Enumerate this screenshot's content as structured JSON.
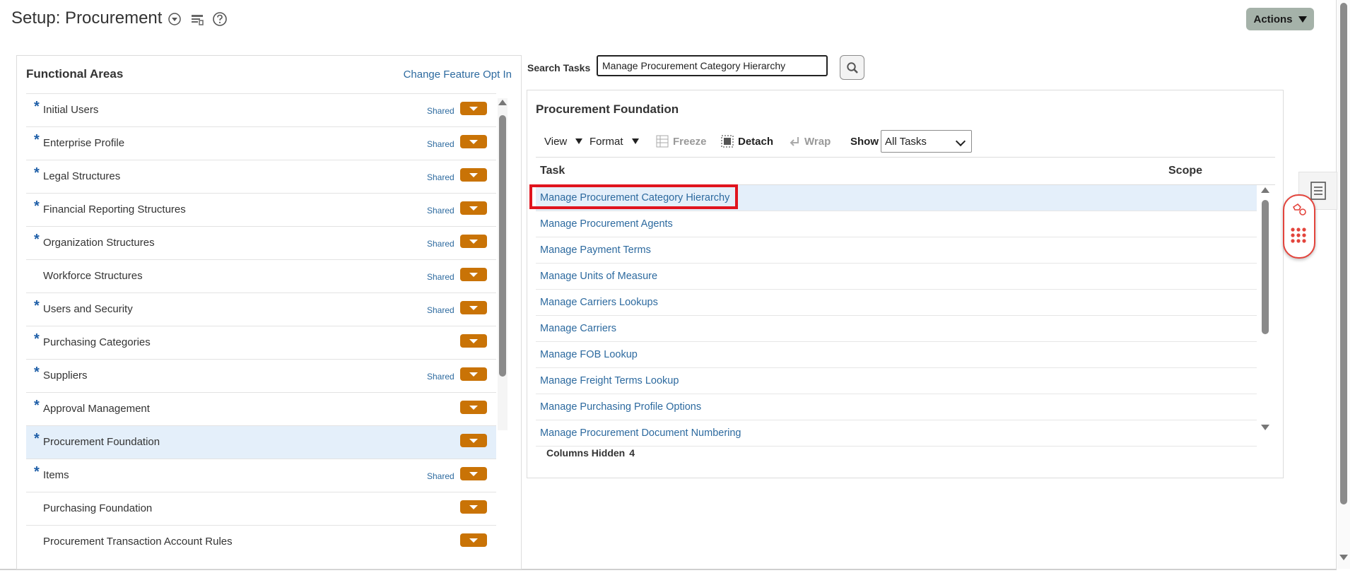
{
  "page": {
    "title": "Setup: Procurement",
    "actions_label": "Actions"
  },
  "functional_areas": {
    "header": "Functional Areas",
    "change_link": "Change Feature Opt In",
    "items": [
      {
        "label": "Initial Users",
        "required": true,
        "shared": "Shared"
      },
      {
        "label": "Enterprise Profile",
        "required": true,
        "shared": "Shared"
      },
      {
        "label": "Legal Structures",
        "required": true,
        "shared": "Shared"
      },
      {
        "label": "Financial Reporting Structures",
        "required": true,
        "shared": "Shared"
      },
      {
        "label": "Organization Structures",
        "required": true,
        "shared": "Shared"
      },
      {
        "label": "Workforce Structures",
        "required": false,
        "shared": "Shared"
      },
      {
        "label": "Users and Security",
        "required": true,
        "shared": "Shared"
      },
      {
        "label": "Purchasing Categories",
        "required": true,
        "shared": ""
      },
      {
        "label": "Suppliers",
        "required": true,
        "shared": "Shared"
      },
      {
        "label": "Approval Management",
        "required": true,
        "shared": ""
      },
      {
        "label": "Procurement Foundation",
        "required": true,
        "shared": "",
        "selected": true
      },
      {
        "label": "Items",
        "required": true,
        "shared": "Shared"
      },
      {
        "label": "Purchasing Foundation",
        "required": false,
        "shared": ""
      },
      {
        "label": "Procurement Transaction Account Rules",
        "required": false,
        "shared": ""
      }
    ],
    "required_marker": "*"
  },
  "search": {
    "label": "Search Tasks",
    "value": "Manage Procurement Category Hierarchy"
  },
  "tasks_panel": {
    "header": "Procurement Foundation",
    "toolbar": {
      "view": "View",
      "format": "Format",
      "freeze": "Freeze",
      "detach": "Detach",
      "wrap": "Wrap",
      "show": "Show",
      "show_value": "All Tasks"
    },
    "columns": {
      "task": "Task",
      "scope": "Scope"
    },
    "rows": [
      "Manage Procurement Category Hierarchy",
      "Manage Procurement Agents",
      "Manage Payment Terms",
      "Manage Units of Measure",
      "Manage Carriers Lookups",
      "Manage Carriers",
      "Manage FOB Lookup",
      "Manage Freight Terms Lookup",
      "Manage Purchasing Profile Options",
      "Manage Procurement Document Numbering"
    ],
    "columns_hidden_label": "Columns Hidden",
    "columns_hidden_count": "4"
  },
  "colors": {
    "link": "#2d6a9f",
    "dropdown": "#c97306",
    "selected_row": "#e4effa",
    "highlight": "#e0141e",
    "actions_bg": "#a5b2a9"
  }
}
